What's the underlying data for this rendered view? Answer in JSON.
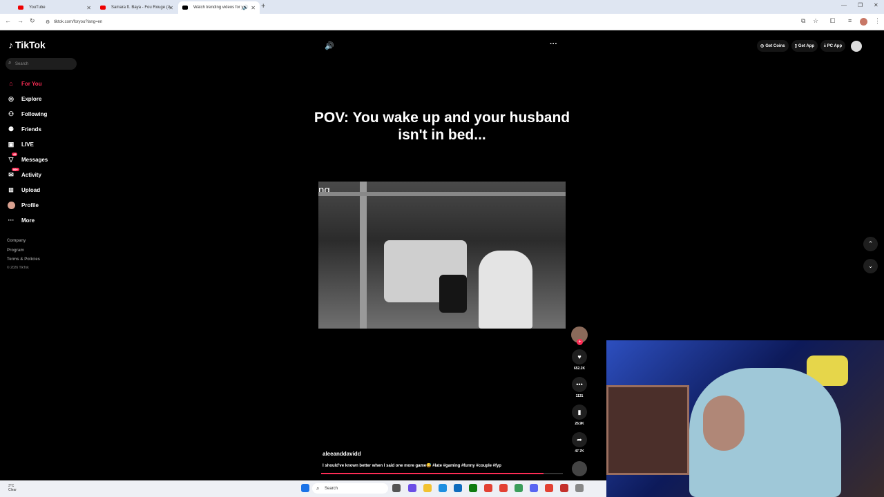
{
  "browser": {
    "tabs": [
      {
        "title": "YouTube",
        "icon": "youtube-icon"
      },
      {
        "title": "Samara ft. Baya - Fou Rouge (A",
        "icon": "youtube-icon"
      },
      {
        "title": "Watch trending videos for y",
        "icon": "tiktok-icon"
      }
    ],
    "url": "tiktok.com/foryou?lang=en"
  },
  "tiktok": {
    "logo_text": "TikTok",
    "search_placeholder": "Search",
    "nav": [
      {
        "label": "For You",
        "icon": "home-icon",
        "active": true
      },
      {
        "label": "Explore",
        "icon": "compass-icon"
      },
      {
        "label": "Following",
        "icon": "following-icon"
      },
      {
        "label": "Friends",
        "icon": "friends-icon"
      },
      {
        "label": "LIVE",
        "icon": "live-icon"
      },
      {
        "label": "Messages",
        "icon": "messages-icon",
        "badge": "45"
      },
      {
        "label": "Activity",
        "icon": "activity-icon",
        "badge": "99+"
      },
      {
        "label": "Upload",
        "icon": "upload-icon"
      },
      {
        "label": "Profile",
        "icon": "profile-avatar"
      },
      {
        "label": "More",
        "icon": "more-icon"
      }
    ],
    "footer": {
      "company": "Company",
      "program": "Program",
      "terms": "Terms & Policies",
      "copyright": "© 2026 TikTok"
    },
    "top_actions": {
      "coins": "Get Coins",
      "app": "Get App",
      "pc": "PC App"
    },
    "video": {
      "caption": "POV: You wake up and your husband isn't in bed...",
      "overlay_text": "ng",
      "author": "aleeanddavidd",
      "description": "I should've known better when I said one more game😅 #late #gaming #funny #couple #fyp",
      "likes": "652.2K",
      "comments": "1131",
      "saves": "26.9K",
      "shares": "47.7K",
      "progress": 0.92
    }
  },
  "taskbar": {
    "search_placeholder": "Search",
    "weather_temp": "3°C",
    "weather_cond": "Clear"
  }
}
